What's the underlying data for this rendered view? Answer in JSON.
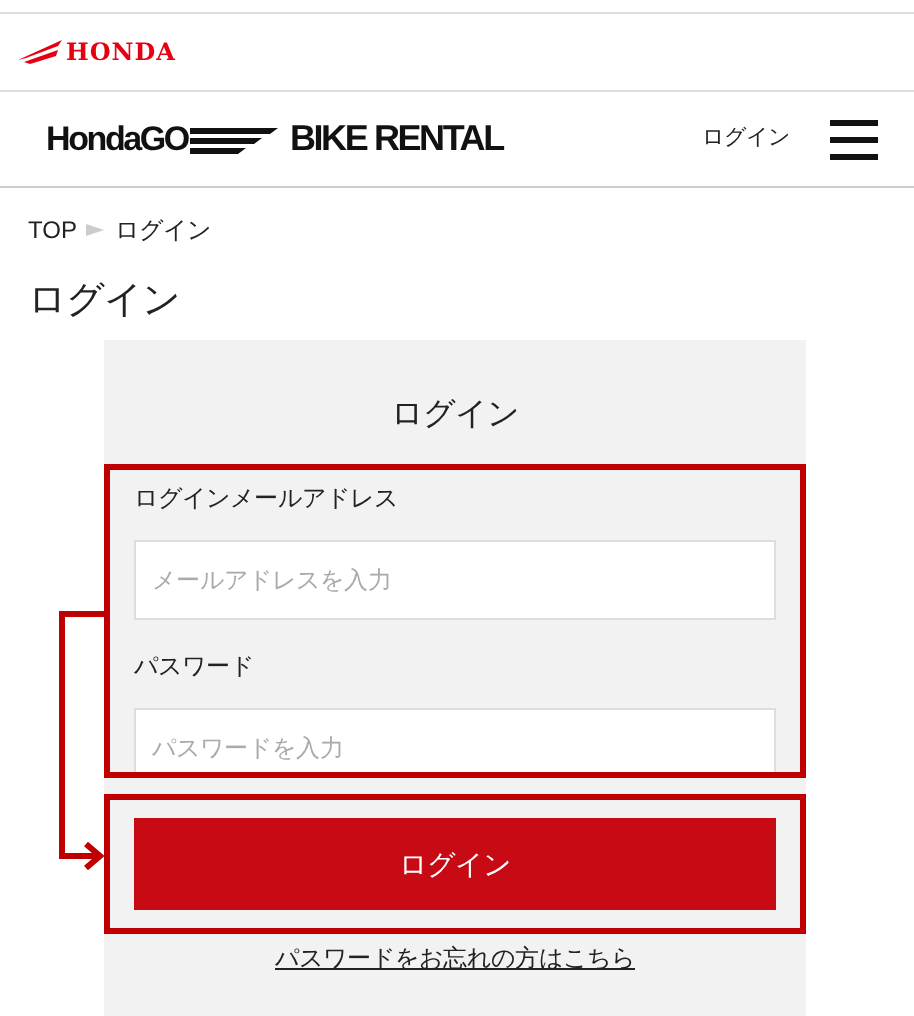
{
  "brand_bar": {
    "logo_text": "HONDA"
  },
  "header": {
    "logo_left": "HondaGO",
    "logo_right": "BIKE RENTAL",
    "login_link": "ログイン"
  },
  "breadcrumb": [
    {
      "label": "TOP"
    },
    {
      "label": "ログイン"
    }
  ],
  "page_title": "ログイン",
  "login_card": {
    "title": "ログイン",
    "fields": [
      {
        "label": "ログインメールアドレス",
        "placeholder": "メールアドレスを入力"
      },
      {
        "label": "パスワード",
        "placeholder": "パスワードを入力"
      }
    ],
    "submit": "ログイン",
    "forgot_link": "パスワードをお忘れの方はこちら"
  }
}
